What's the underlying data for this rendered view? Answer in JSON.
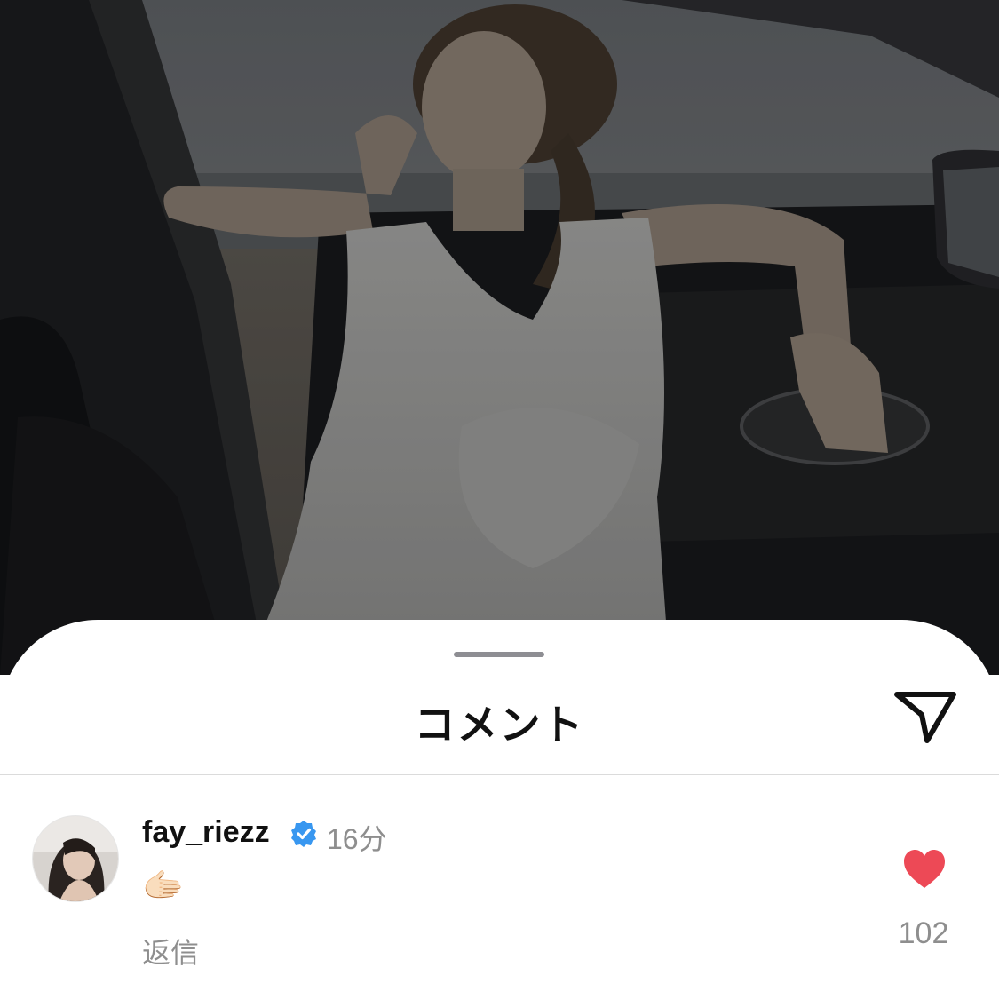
{
  "sheet": {
    "title": "コメント",
    "share_icon": "send-paper-plane-icon",
    "grabber_icon": "drag-handle"
  },
  "comment": {
    "username": "fay_riezz",
    "verified_icon": "verified-badge-icon",
    "timestamp": "16分",
    "text": "🫱🏻",
    "reply_label": "返信",
    "like_icon": "heart-filled-icon",
    "like_count": "102"
  },
  "colors": {
    "like": "#ed4956",
    "verified": "#3897f0",
    "muted_text": "#8e8e8e"
  }
}
